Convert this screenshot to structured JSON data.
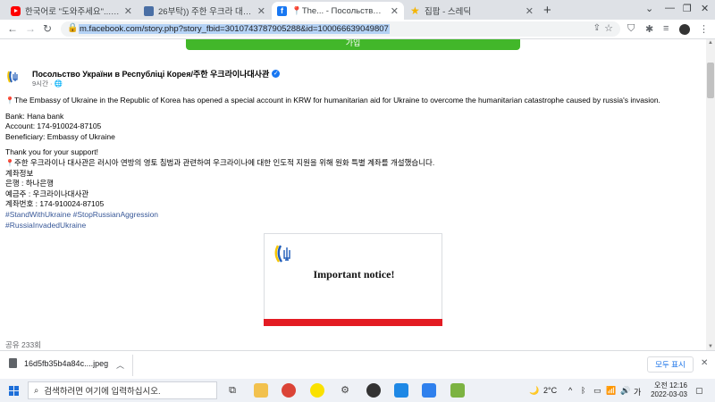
{
  "tabs": [
    {
      "title": "한국어로 \"도와주세요\"...우크라이",
      "favicon": "youtube-icon",
      "active": false
    },
    {
      "title": "26부탁)) 주한 우크라 대사관 모",
      "favicon": "site-icon",
      "active": false
    },
    {
      "title": "📍The... - Посольство Украіни в",
      "favicon": "facebook-icon",
      "active": true
    },
    {
      "title": "집팝 - 스레딕",
      "favicon": "star-icon",
      "active": false
    }
  ],
  "toolbar": {
    "url": "m.facebook.com/story.php?story_fbid=3010743787905288&id=100066639049807"
  },
  "page": {
    "top_button": "가입",
    "post": {
      "author": "Посольство України в Республіці Корея/주한 우크라이나대사관",
      "meta": "9시간 · 🌐",
      "english_announcement": "The Embassy of Ukraine in the Republic of Korea has opened a special account in KRW for humanitarian aid for Ukraine to overcome the humanitarian catastrophe caused by russia's invasion.",
      "bank": "Bank: Hana bank",
      "account": "Account: 174-910024-87105",
      "beneficiary": "Beneficiary: Embassy of Ukraine",
      "thanks": "Thank you for your support!",
      "korean_announcement": "주한 우크라이나 대사관은 러시아 연방의 영토 침범과 관련하여 우크라이나에 대한 인도적 지원을 위해 원화 특별 계좌를 개설했습니다.",
      "kr_account_info": "계좌정보",
      "kr_bank": "은행 : 하나은행",
      "kr_holder": "예금주 : 우크라이나대사관",
      "kr_account_no": "계좌번호 : 174-910024-87105",
      "hashtags_1": "#StandWithUkraine #StopRussianAggression",
      "hashtags_2": "#RussiaInvadedUkraine",
      "notice_title": "Important notice!"
    },
    "share_count": "공유 233회"
  },
  "downloads": {
    "file_name": "16d5fb35b4a84c....jpeg",
    "show_all": "모두 표시"
  },
  "taskbar": {
    "search_placeholder": "검색하려면 여기에 입력하십시오.",
    "weather": "2°C",
    "ime": "가",
    "time": "오전 12:16",
    "date": "2022-03-03"
  },
  "colors": {
    "facebook_blue": "#1877f2",
    "signup_green": "#42b72a",
    "notice_red": "#e31b23",
    "url_highlight": "#b4d2f5"
  }
}
